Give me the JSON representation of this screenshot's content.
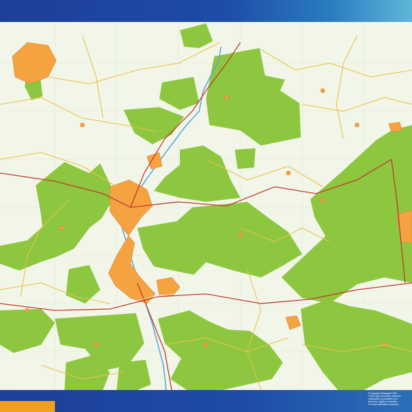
{
  "map": {
    "forest_color": "#8dc63f",
    "background_color": "#f2f6e8",
    "town_color": "#f4a340",
    "road_major_color": "#c0392b",
    "road_minor_color": "#e9c34a",
    "river_color": "#5aa9dd"
  },
  "banner": {
    "top_gradient": [
      "#1d3f9a",
      "#5fb6d8"
    ],
    "bottom_color": "#1e4ca8",
    "tab_color": "#f2a020"
  },
  "copyright": {
    "lines": [
      "© Copyright Ottomapp® 1997-...",
      "These maps have been conforme...",
      "reproduction is prohibited, exc...",
      "electronic, digital or mechanic...",
      "For more information consult w..."
    ]
  }
}
